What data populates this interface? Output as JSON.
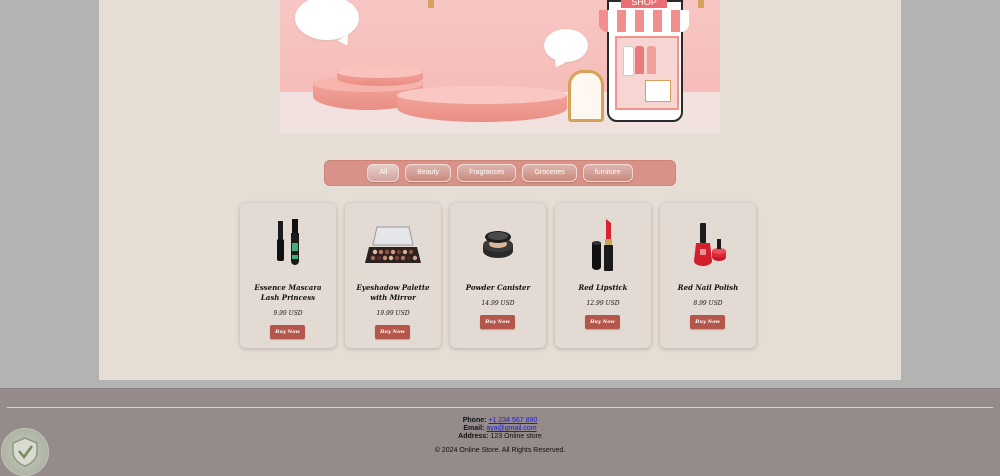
{
  "filters": {
    "items": [
      {
        "label": "All",
        "active": true
      },
      {
        "label": "Beauty",
        "active": false
      },
      {
        "label": "Fragrances",
        "active": false
      },
      {
        "label": "Groceries",
        "active": false
      },
      {
        "label": "furniture",
        "active": false
      }
    ]
  },
  "products": [
    {
      "name": "Essence Mascara Lash Princess",
      "price": "9.99 USD",
      "button": "Buy Now",
      "icon": "mascara-icon"
    },
    {
      "name": "Eyeshadow Palette with Mirror",
      "price": "19.99 USD",
      "button": "Buy Now",
      "icon": "eyeshadow-palette-icon"
    },
    {
      "name": "Powder Canister",
      "price": "14.99 USD",
      "button": "Buy Now",
      "icon": "powder-canister-icon"
    },
    {
      "name": "Red Lipstick",
      "price": "12.99 USD",
      "button": "Buy Now",
      "icon": "lipstick-icon"
    },
    {
      "name": "Red Nail Polish",
      "price": "8.99 USD",
      "button": "Buy Now",
      "icon": "nail-polish-icon"
    }
  ],
  "footer": {
    "phone_label": "Phone:",
    "phone": "+1 234 567 890",
    "email_label": "Email:",
    "email": "aya@gmail.com",
    "address_label": "Address:",
    "address": "123 Online store",
    "copyright": "© 2024 Online Store. All Rights Reserved."
  },
  "hero": {
    "sign": "SHOP"
  },
  "colors": {
    "accent": "#b4564a",
    "filter_bar": "#d89288",
    "page_bg": "#e6ddd5",
    "footer_bg": "#948b8a"
  }
}
